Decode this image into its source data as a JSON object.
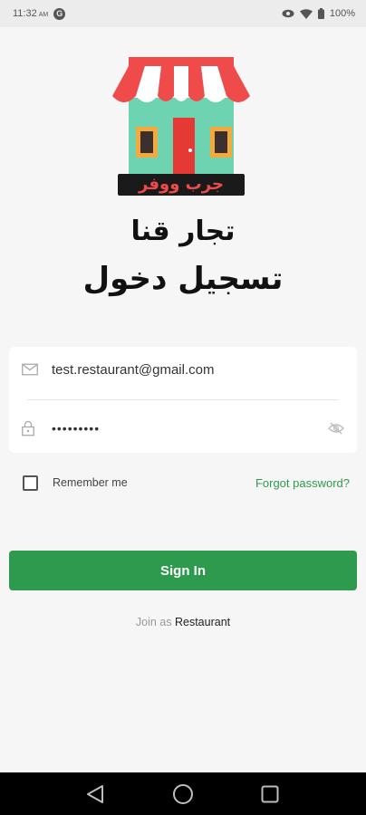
{
  "status_bar": {
    "time": "11:32",
    "time_suffix": "AM",
    "app_badge": "G",
    "battery": "100%"
  },
  "logo": {
    "sign_text": "جرب ووفر"
  },
  "titles": {
    "line1": "تجار قنا",
    "line2": "تسجيل دخول"
  },
  "form": {
    "email_value": "test.restaurant@gmail.com",
    "password_value": "•••••••••"
  },
  "remember_label": "Remember me",
  "forgot_label": "Forgot password?",
  "signin_label": "Sign In",
  "join": {
    "prefix": "Join as",
    "link": "Restaurant"
  },
  "colors": {
    "accent": "#2e9a4e",
    "awning_red": "#f04b4b",
    "house_green": "#6ed3b0"
  }
}
